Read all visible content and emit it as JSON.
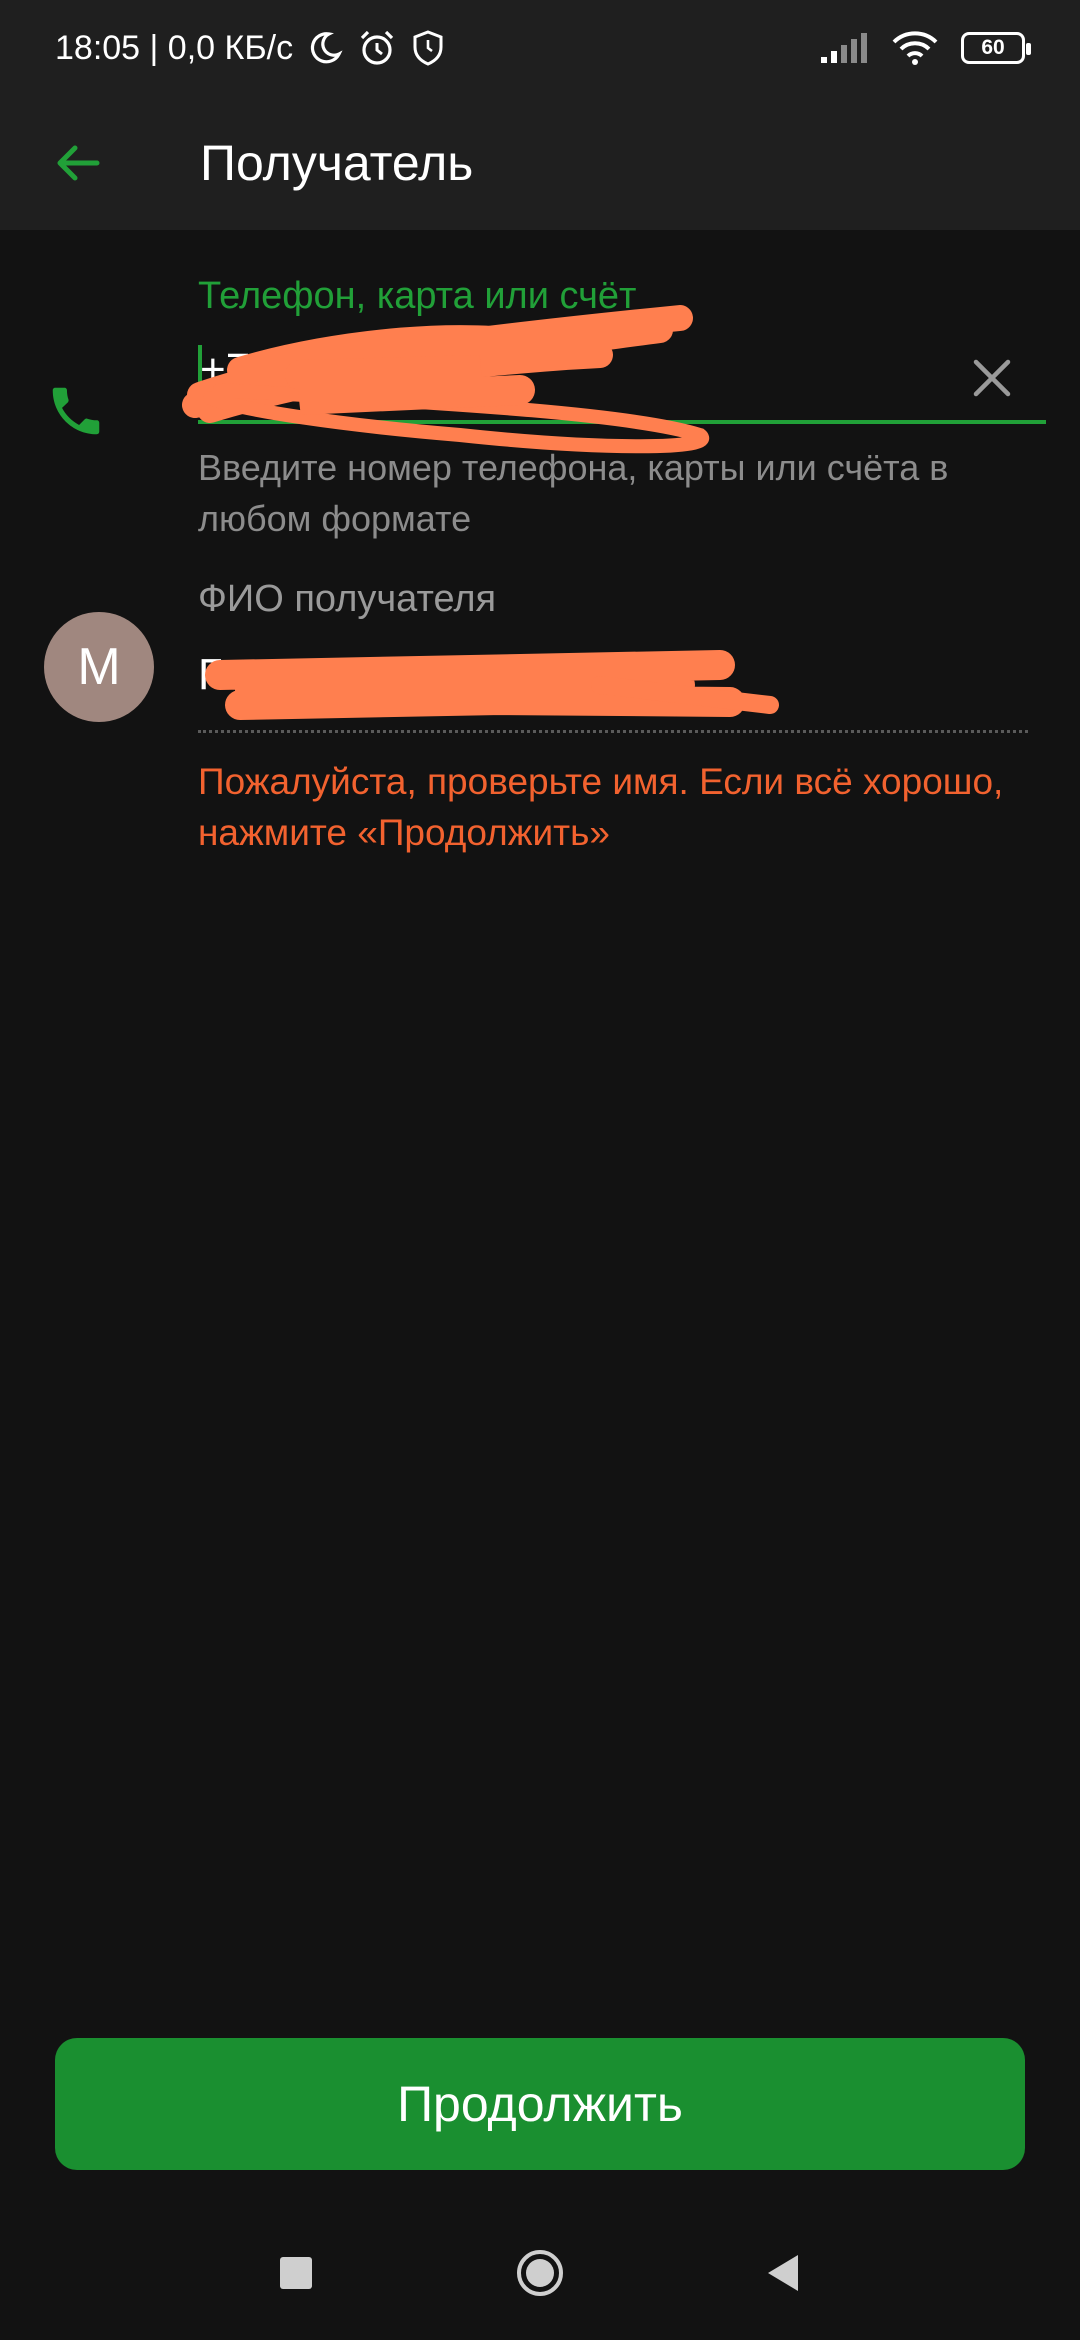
{
  "status_bar": {
    "time_speed": "18:05 | 0,0 КБ/с",
    "battery_level": "60",
    "icons": [
      "moon-icon",
      "alarm-icon",
      "shield-icon",
      "signal-icon",
      "wifi-icon",
      "battery-icon"
    ]
  },
  "app_bar": {
    "title": "Получатель",
    "back_icon": "arrow-left-icon"
  },
  "phone_field": {
    "label": "Телефон, карта или счёт",
    "value": "+7",
    "helper": "Введите номер телефона, карты или счёта в любом формате",
    "clear_icon": "close-icon",
    "leading_icon": "phone-icon"
  },
  "name_field": {
    "avatar_letter": "М",
    "label": "ФИО получателя",
    "value": "Г",
    "warning": "Пожалуйста, проверьте имя. Если всё хорошо, нажмите «Продолжить»"
  },
  "actions": {
    "continue_label": "Продолжить"
  },
  "colors": {
    "accent": "#21a038",
    "button": "#1a8f30",
    "warning": "#f2622f",
    "background": "#121212",
    "appbar": "#1f1f1f",
    "redaction": "#ff7f4f"
  }
}
